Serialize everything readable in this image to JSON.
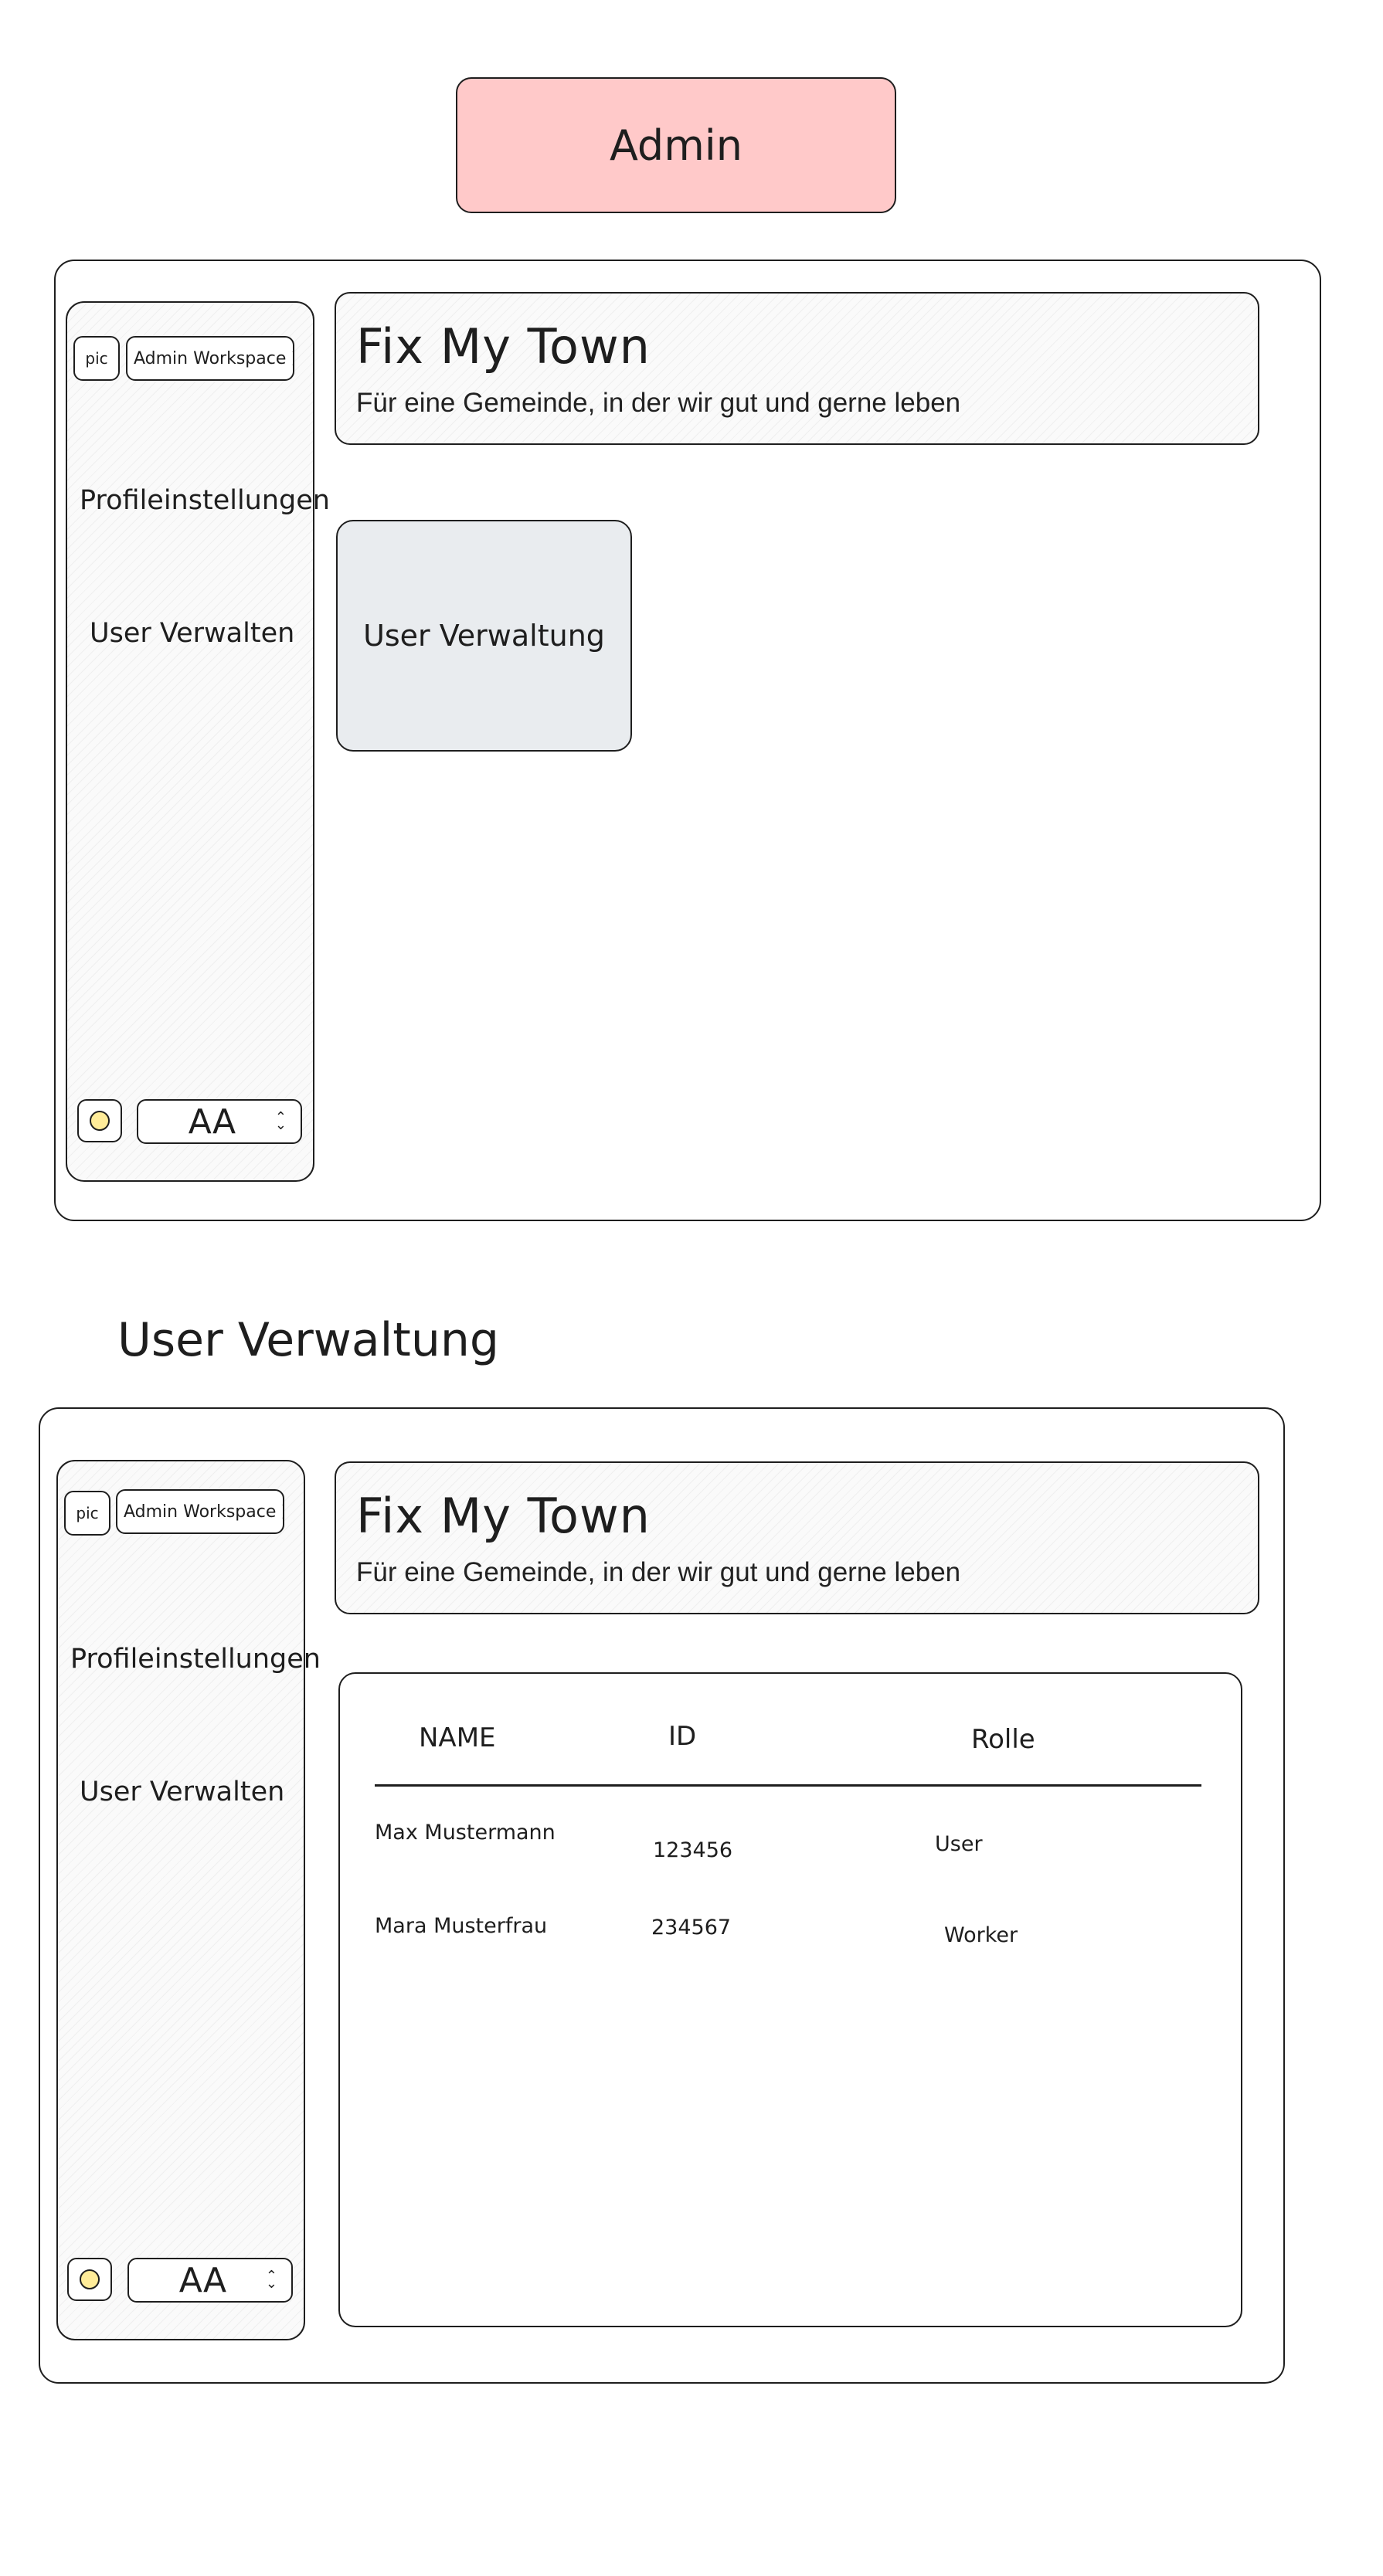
{
  "admin_label": "Admin",
  "section_title": "User Verwaltung",
  "screens": [
    {
      "sidebar": {
        "pic_label": "pic",
        "workspace_label": "Admin Workspace",
        "items": [
          "Profileinstellungen",
          "User Verwalten"
        ],
        "font_select_label": "AA"
      },
      "header": {
        "title": "Fix My Town",
        "subtitle": "Für eine Gemeinde, in der wir gut und gerne leben"
      },
      "card_label": "User Verwaltung"
    },
    {
      "sidebar": {
        "pic_label": "pic",
        "workspace_label": "Admin Workspace",
        "items": [
          "Profileinstellungen",
          "User Verwalten"
        ],
        "font_select_label": "AA"
      },
      "header": {
        "title": "Fix My Town",
        "subtitle": "Für eine Gemeinde, in der wir gut und gerne leben"
      },
      "table": {
        "columns": [
          "NAME",
          "ID",
          "Rolle"
        ],
        "rows": [
          [
            "Max Mustermann",
            "123456",
            "User"
          ],
          [
            "Mara Musterfrau",
            "234567",
            "Worker"
          ]
        ]
      }
    }
  ],
  "colors": {
    "admin_fill": "#ffc9c9",
    "card_fill": "#e9ecef",
    "theme_dot": "#ffec99",
    "stroke": "#1e1e1e"
  },
  "icons": {
    "theme_toggle": "sun-dot-icon",
    "select_chevron": "up-down-chevron-icon"
  }
}
